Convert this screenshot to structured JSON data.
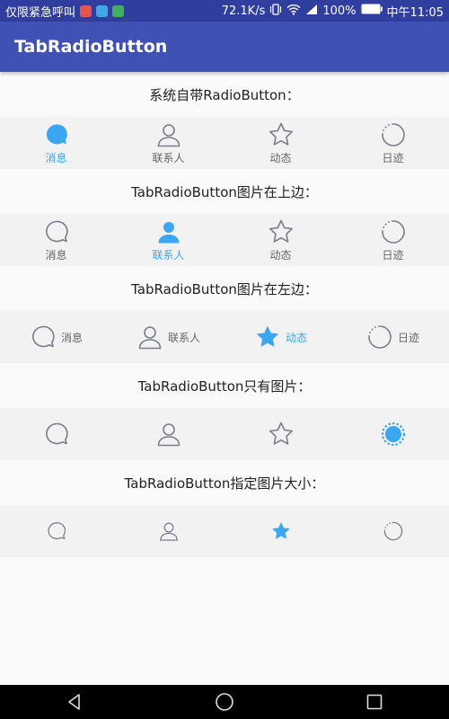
{
  "status_bar": {
    "left_text": "仅限紧急呼叫",
    "speed": "72.1K/s",
    "battery": "100%",
    "time": "中午11:05"
  },
  "app_bar": {
    "title": "TabRadioButton"
  },
  "sections": [
    {
      "label": "系统自带RadioButton：",
      "mode": "top",
      "icon_size": 30,
      "tabs": [
        {
          "label": "消息",
          "icon": "chat-bubble-icon",
          "checked": true
        },
        {
          "label": "联系人",
          "icon": "person-icon",
          "checked": false
        },
        {
          "label": "动态",
          "icon": "star-icon",
          "checked": false
        },
        {
          "label": "日迹",
          "icon": "progress-ring-icon",
          "checked": false
        }
      ]
    },
    {
      "label": "TabRadioButton图片在上边：",
      "mode": "top",
      "icon_size": 30,
      "tabs": [
        {
          "label": "消息",
          "icon": "chat-bubble-icon",
          "checked": false
        },
        {
          "label": "联系人",
          "icon": "person-icon",
          "checked": true
        },
        {
          "label": "动态",
          "icon": "star-icon",
          "checked": false
        },
        {
          "label": "日迹",
          "icon": "progress-ring-icon",
          "checked": false
        }
      ]
    },
    {
      "label": "TabRadioButton图片在左边：",
      "mode": "left",
      "icon_size": 30,
      "tabs": [
        {
          "label": "消息",
          "icon": "chat-bubble-icon",
          "checked": false
        },
        {
          "label": "联系人",
          "icon": "person-icon",
          "checked": false
        },
        {
          "label": "动态",
          "icon": "star-icon",
          "checked": true
        },
        {
          "label": "日迹",
          "icon": "progress-ring-icon",
          "checked": false
        }
      ]
    },
    {
      "label": "TabRadioButton只有图片：",
      "mode": "icon",
      "icon_size": 30,
      "tabs": [
        {
          "label": "",
          "icon": "chat-bubble-icon",
          "checked": false
        },
        {
          "label": "",
          "icon": "person-icon",
          "checked": false
        },
        {
          "label": "",
          "icon": "star-icon",
          "checked": false
        },
        {
          "label": "",
          "icon": "progress-ring-icon",
          "checked": true
        }
      ]
    },
    {
      "label": "TabRadioButton指定图片大小：",
      "mode": "icon",
      "icon_size": 24,
      "tabs": [
        {
          "label": "",
          "icon": "chat-bubble-icon",
          "checked": false
        },
        {
          "label": "",
          "icon": "person-icon",
          "checked": false
        },
        {
          "label": "",
          "icon": "star-icon",
          "checked": true
        },
        {
          "label": "",
          "icon": "progress-ring-icon",
          "checked": false
        }
      ]
    }
  ],
  "colors": {
    "primary": "#3F51B5",
    "primary_dark": "#303F9F",
    "accent_checked": "#3BA7F3",
    "icon_unchecked": "#7A7E8C"
  },
  "nav_bar": {
    "buttons": [
      "back-icon",
      "home-icon",
      "recents-icon"
    ]
  }
}
